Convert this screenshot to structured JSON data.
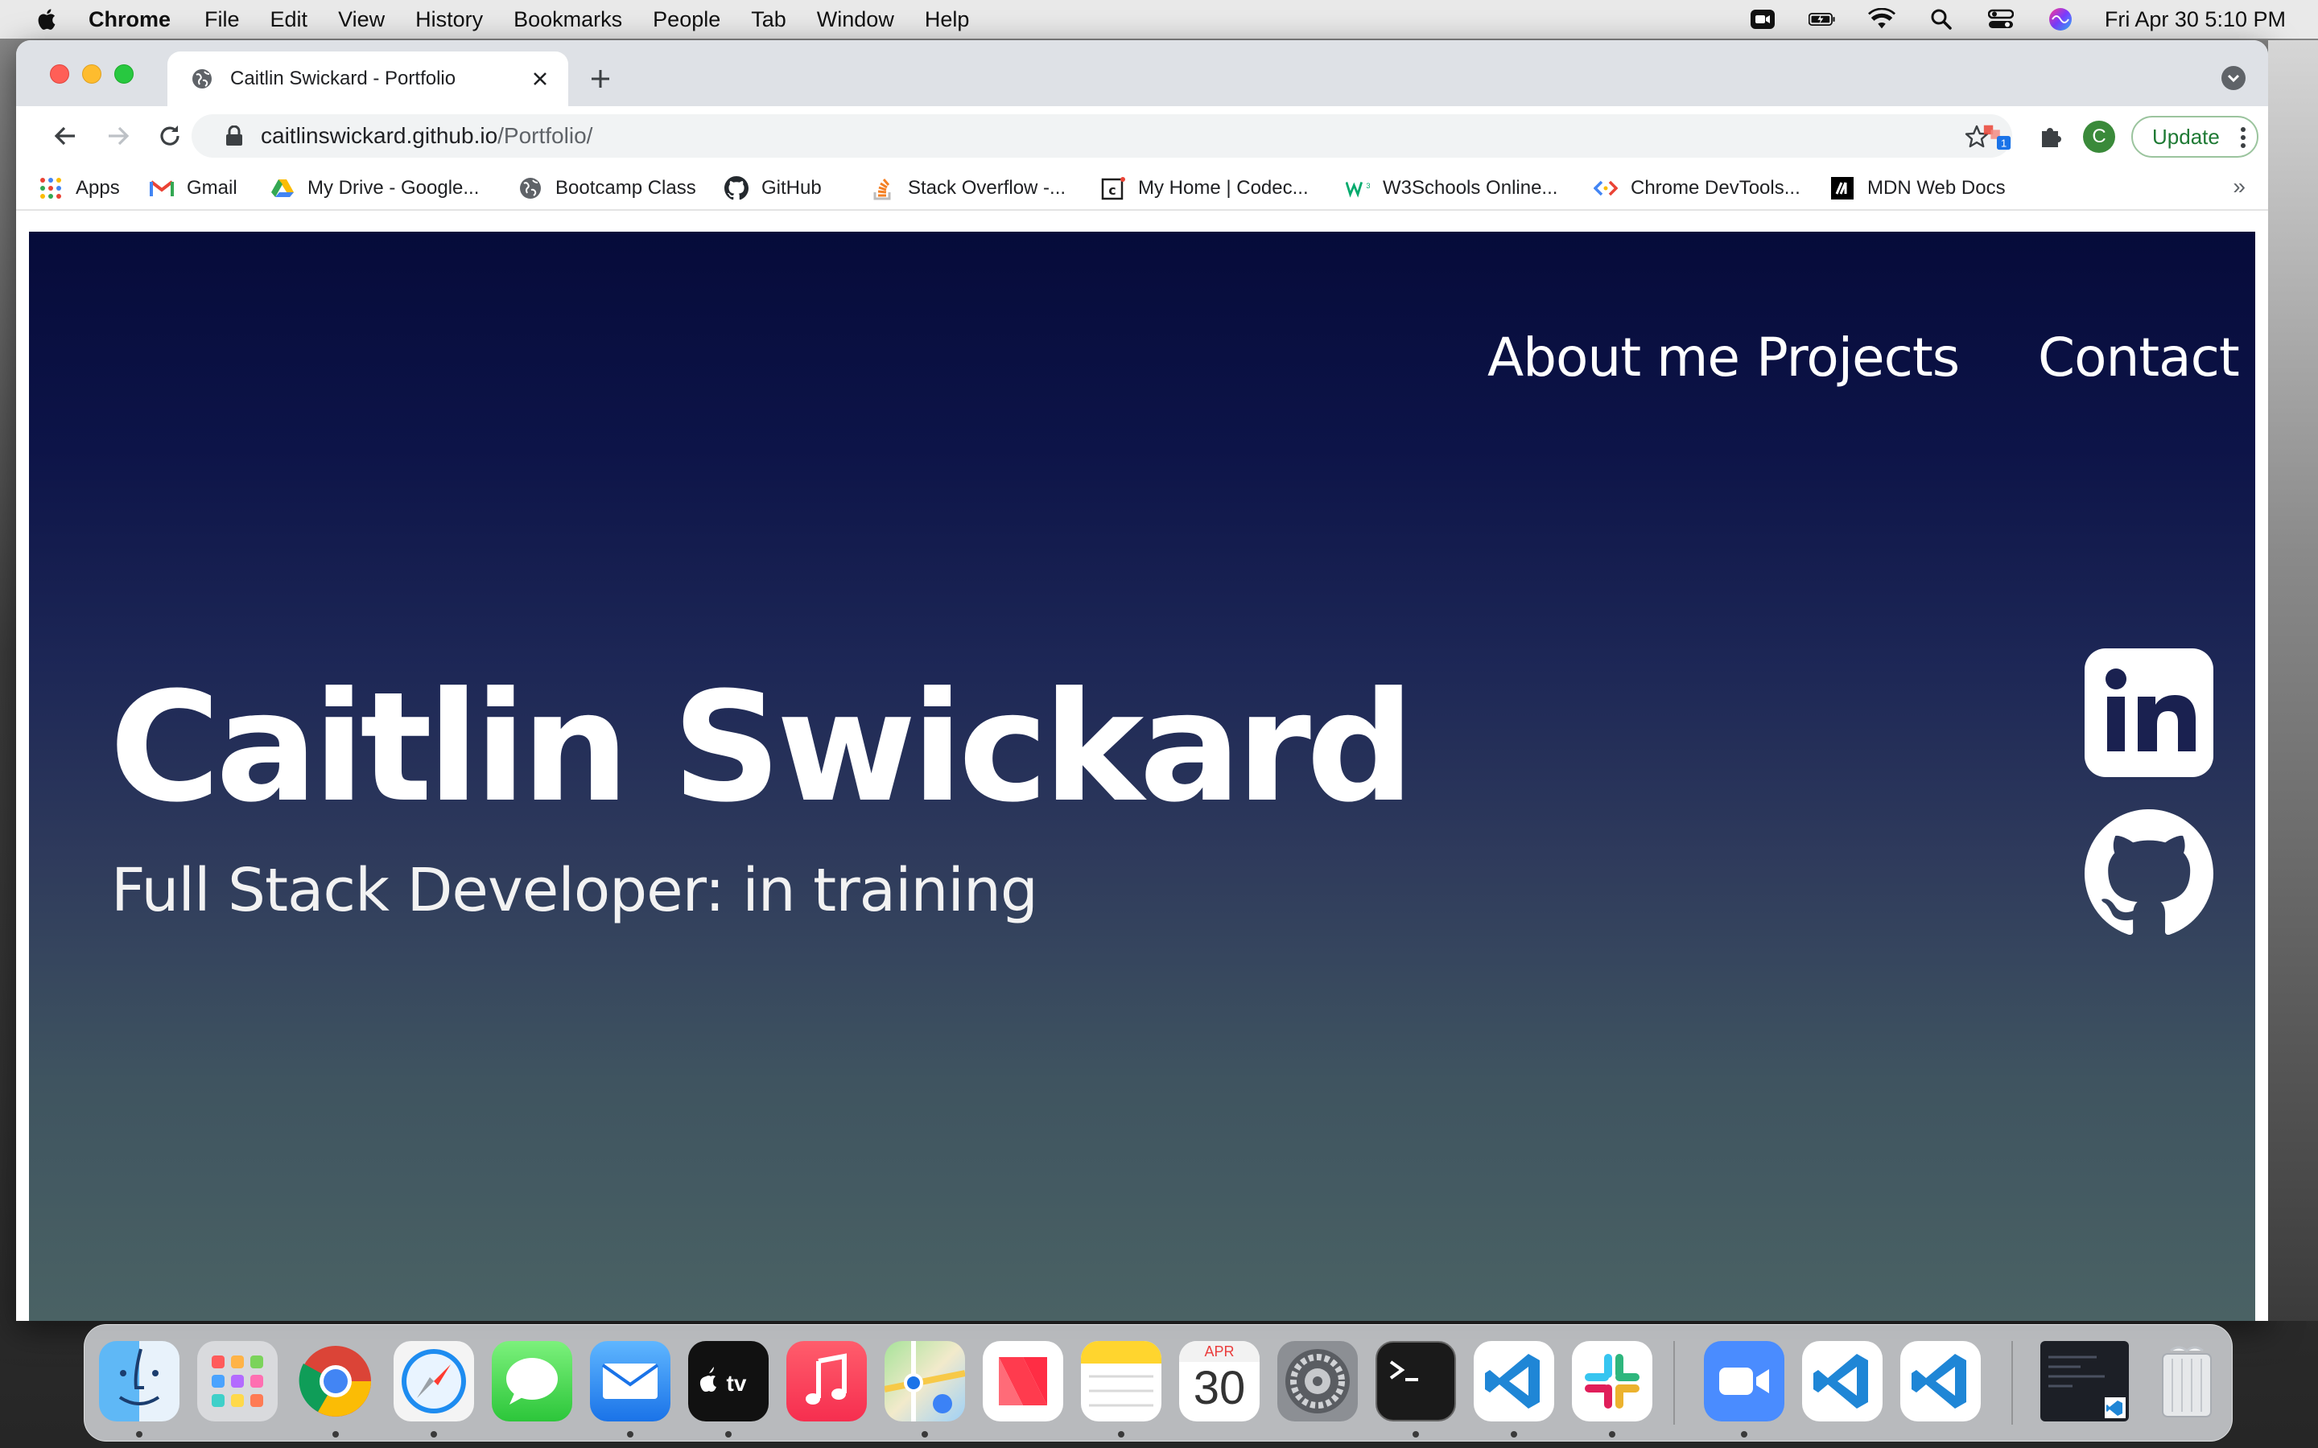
{
  "menubar": {
    "app_name": "Chrome",
    "menus": [
      "File",
      "Edit",
      "View",
      "History",
      "Bookmarks",
      "People",
      "Tab",
      "Window",
      "Help"
    ],
    "clock": "Fri Apr 30  5:10 PM"
  },
  "browser": {
    "tab_title": "Caitlin Swickard - Portfolio",
    "url_host": "caitlinswickard.github.io",
    "url_path": "/Portfolio/",
    "extension_badge": "1",
    "profile_initial": "C",
    "update_label": "Update",
    "bookmarks": [
      {
        "label": "Apps",
        "icon": "apps-grid-icon"
      },
      {
        "label": "Gmail",
        "icon": "gmail-icon"
      },
      {
        "label": "My Drive - Google...",
        "icon": "google-drive-icon"
      },
      {
        "label": "Bootcamp Class",
        "icon": "globe-icon"
      },
      {
        "label": "GitHub",
        "icon": "github-icon"
      },
      {
        "label": "Stack Overflow -...",
        "icon": "stack-overflow-icon"
      },
      {
        "label": "My Home | Codec...",
        "icon": "codecademy-icon"
      },
      {
        "label": "W3Schools Online...",
        "icon": "w3schools-icon"
      },
      {
        "label": "Chrome DevTools...",
        "icon": "devtools-icon"
      },
      {
        "label": "MDN Web Docs",
        "icon": "mdn-icon"
      }
    ],
    "bookmarks_overflow": "»"
  },
  "page": {
    "nav": [
      "About me",
      "Projects",
      "Contact"
    ],
    "hero_name": "Caitlin Swickard",
    "hero_subtitle": "Full Stack Developer: in training",
    "social": [
      "linkedin-icon",
      "github-icon"
    ]
  },
  "dock": {
    "calendar_month": "APR",
    "calendar_day": "30",
    "apps": [
      "finder",
      "launchpad",
      "chrome",
      "safari",
      "messages",
      "mail",
      "apple-tv",
      "music",
      "maps",
      "news",
      "notes",
      "calendar",
      "system-preferences",
      "terminal",
      "vscode",
      "slack",
      "zoom",
      "vscode",
      "vscode",
      "terminal-window",
      "trash"
    ]
  },
  "colors": {
    "page_top": "#060b3a",
    "page_bottom": "#4a6264",
    "update_green": "#1e7a34"
  }
}
